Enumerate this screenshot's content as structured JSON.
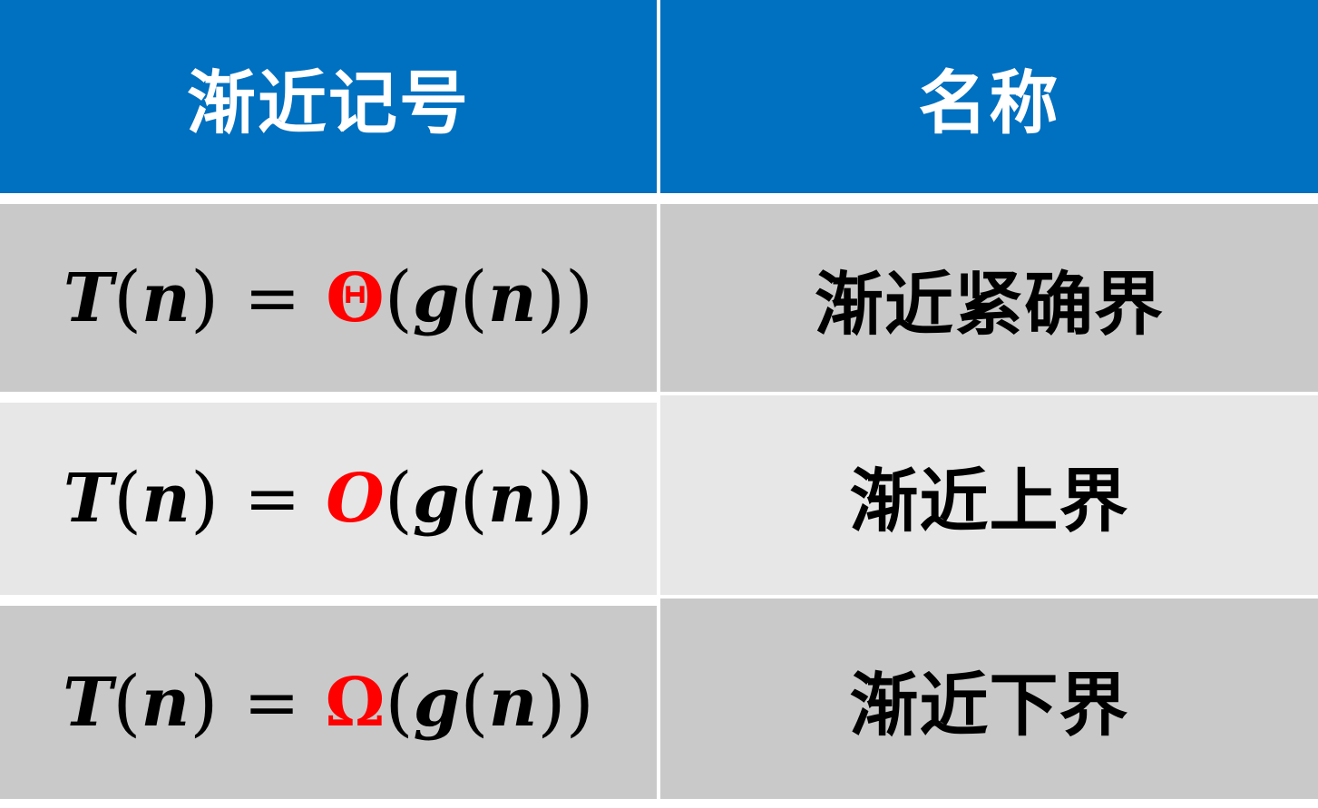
{
  "header": {
    "col_notation": "渐近记号",
    "col_name": "名称"
  },
  "rows": [
    {
      "lhs": "T",
      "var": "n",
      "eq": "=",
      "symbol": "Θ",
      "func": "g",
      "arg": "n",
      "name": "渐近紧确界"
    },
    {
      "lhs": "T",
      "var": "n",
      "eq": "=",
      "symbol": "O",
      "func": "g",
      "arg": "n",
      "name": "渐近上界"
    },
    {
      "lhs": "T",
      "var": "n",
      "eq": "=",
      "symbol": "Ω",
      "func": "g",
      "arg": "n",
      "name": "渐近下界"
    }
  ],
  "colors": {
    "header_bg": "#0070c0",
    "row_dark": "#c9c9c9",
    "row_light": "#e7e7e7",
    "symbol": "#ff0000"
  }
}
